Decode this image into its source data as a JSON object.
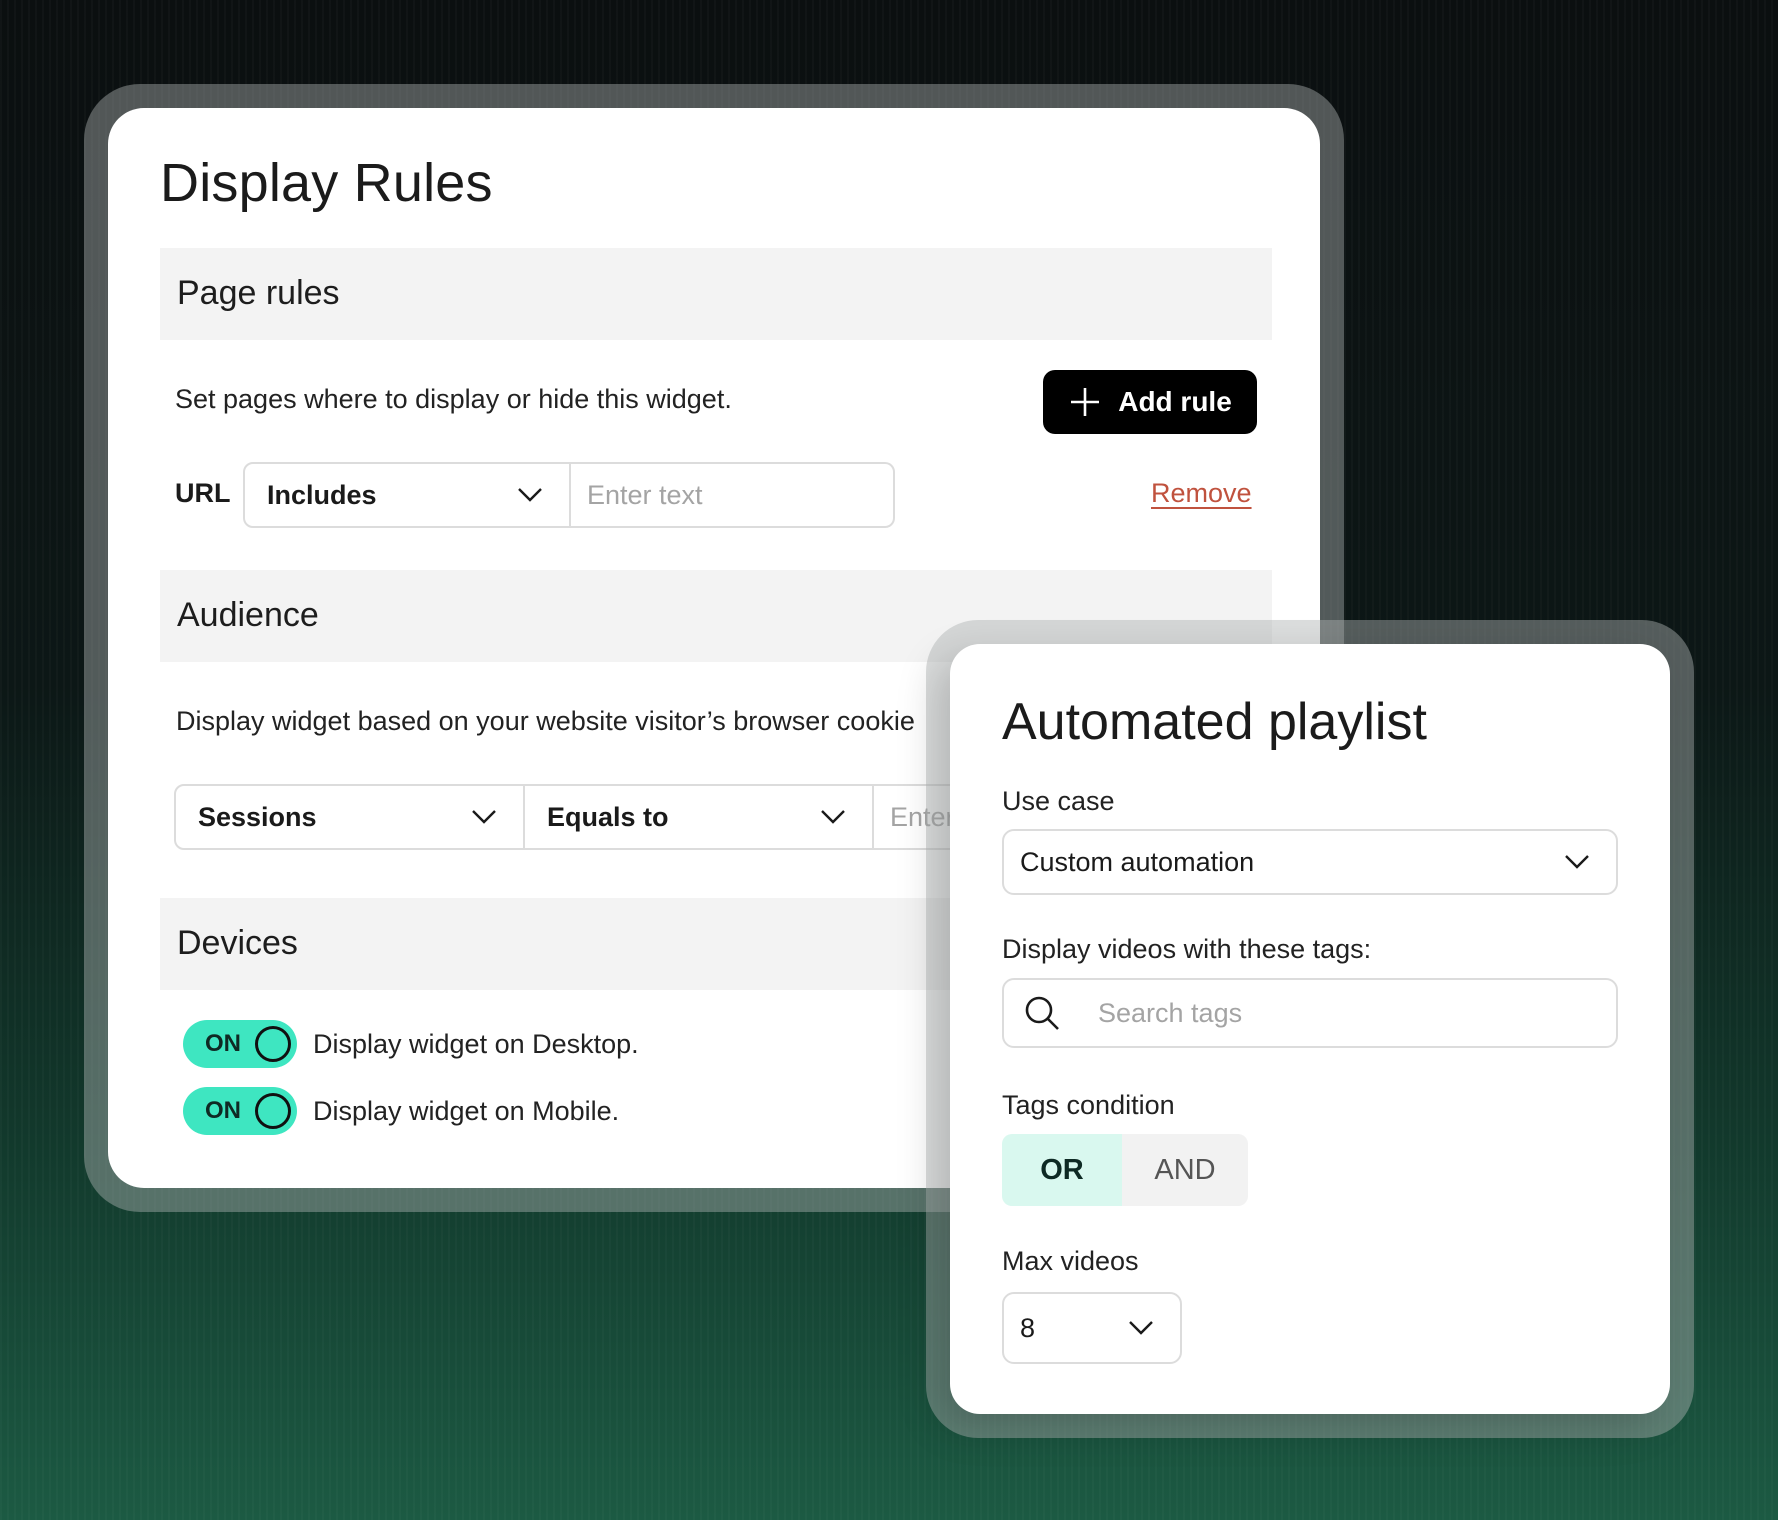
{
  "display_rules": {
    "title": "Display Rules",
    "page_rules": {
      "heading": "Page rules",
      "description": "Set pages where to display or hide this widget.",
      "add_rule_label": "Add rule",
      "url_label": "URL",
      "condition_value": "Includes",
      "text_placeholder": "Enter text",
      "remove_label": "Remove"
    },
    "audience": {
      "heading": "Audience",
      "description": "Display widget based on your website visitor’s browser cookie",
      "attribute_value": "Sessions",
      "operator_value": "Equals to",
      "text_placeholder": "Enter"
    },
    "devices": {
      "heading": "Devices",
      "items": [
        {
          "toggle_label": "ON",
          "label": "Display widget on Desktop."
        },
        {
          "toggle_label": "ON",
          "label": "Display widget on Mobile."
        }
      ]
    }
  },
  "automated_playlist": {
    "title": "Automated playlist",
    "use_case_label": "Use case",
    "use_case_value": "Custom automation",
    "tags_label": "Display videos with these tags:",
    "search_placeholder": "Search tags",
    "tags_condition_label": "Tags condition",
    "condition_options": [
      "OR",
      "AND"
    ],
    "condition_selected": "OR",
    "max_videos_label": "Max videos",
    "max_videos_value": "8"
  },
  "colors": {
    "toggle_on": "#3ee6c1",
    "remove_link": "#c0523e",
    "segment_active": "#d9f8ef",
    "button_bg": "#000000"
  },
  "icons": [
    "plus-icon",
    "chevron-down-icon",
    "search-icon"
  ]
}
